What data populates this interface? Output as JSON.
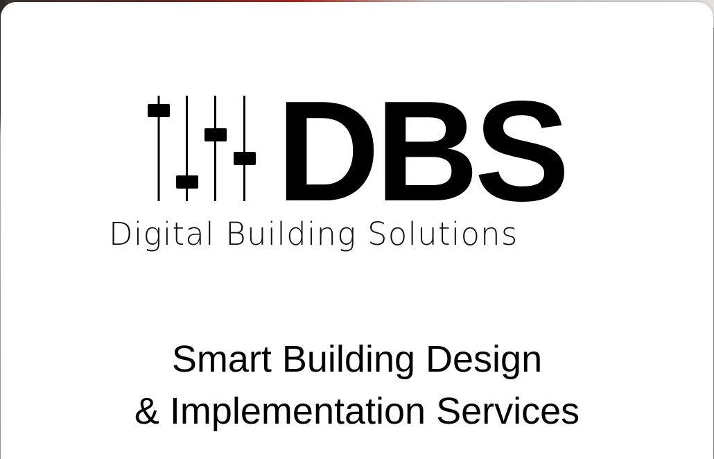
{
  "logo": {
    "icon": "mixer-sliders-icon",
    "acronym": "DBS",
    "full_name": "Digital Building Solutions"
  },
  "tagline": {
    "line1": "Smart Building Design",
    "line2": "& Implementation Services"
  },
  "colors": {
    "text": "#000000",
    "card": "#ffffff",
    "background_accent": "#b3261e"
  }
}
